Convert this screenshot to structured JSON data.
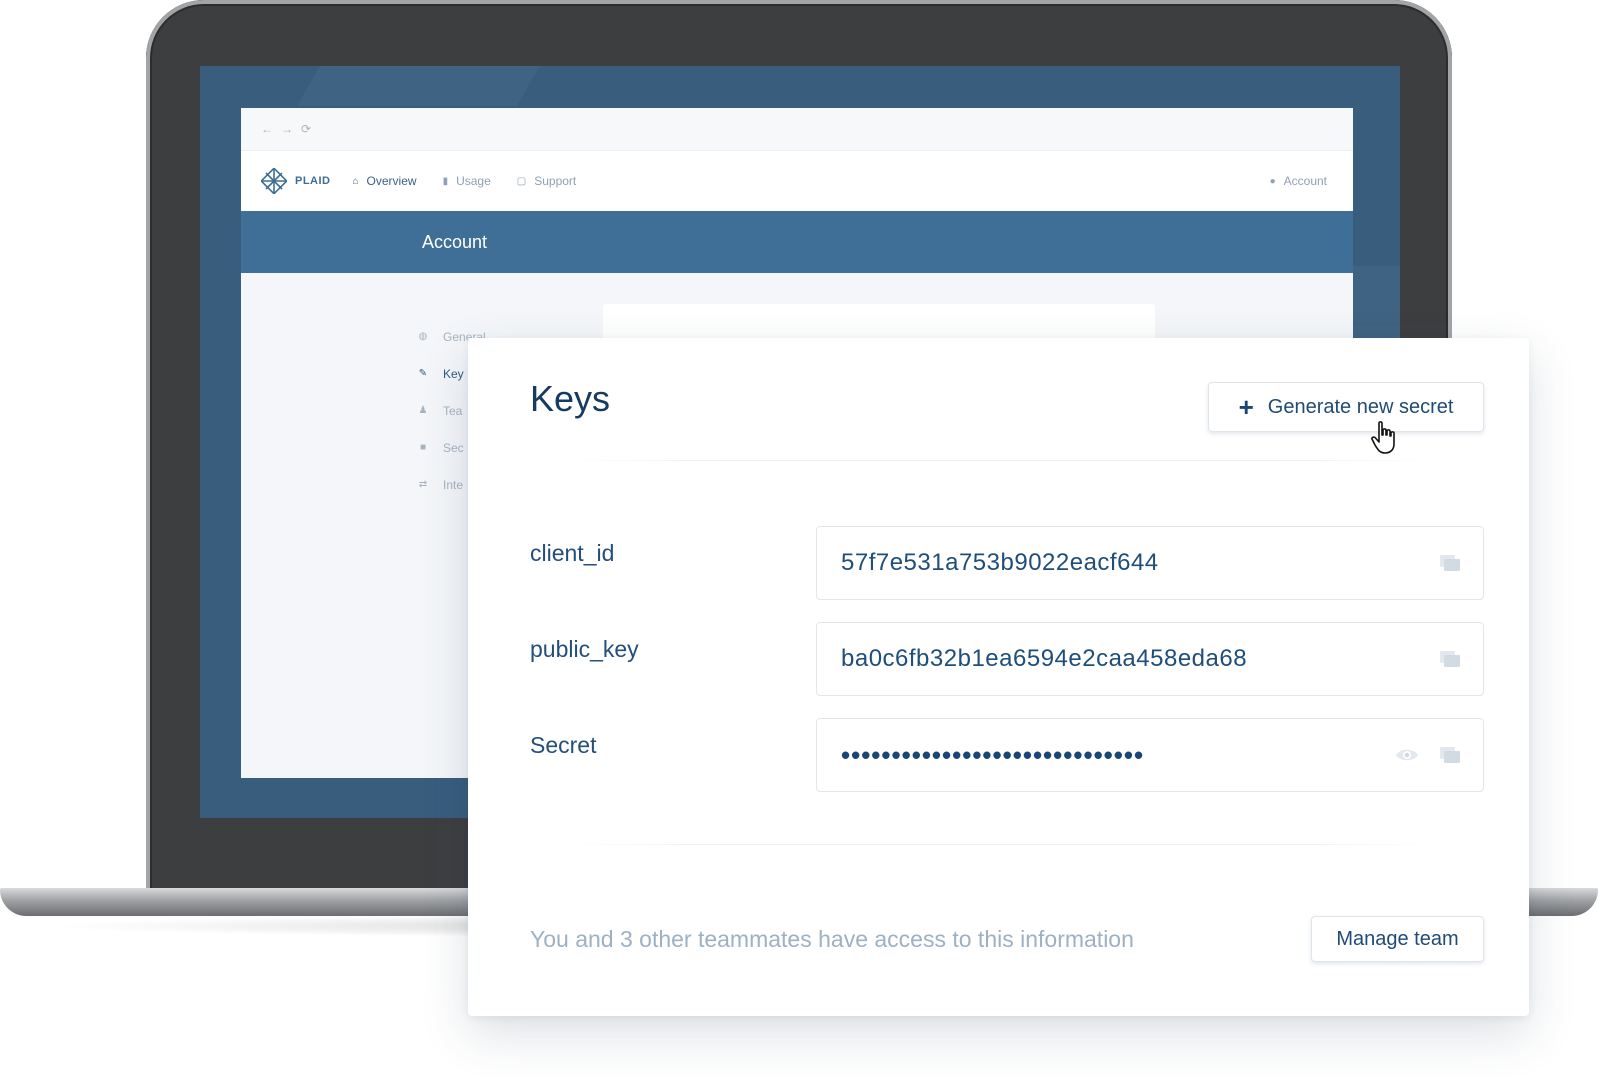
{
  "browser": {
    "nav_back_icon": "arrow-left-icon",
    "nav_forward_icon": "arrow-right-icon",
    "reload_icon": "reload-icon"
  },
  "app_nav": {
    "brand": "PLAID",
    "items": [
      {
        "label": "Overview",
        "icon": "home-icon",
        "active": true
      },
      {
        "label": "Usage",
        "icon": "bar-chart-icon",
        "active": false
      },
      {
        "label": "Support",
        "icon": "chat-icon",
        "active": false
      }
    ],
    "account_label": "Account"
  },
  "banner": {
    "title": "Account"
  },
  "sidebar": {
    "items": [
      {
        "label": "General",
        "icon": "globe-icon"
      },
      {
        "label": "Key",
        "icon": "key-icon"
      },
      {
        "label": "Tea",
        "icon": "team-icon"
      },
      {
        "label": "Sec",
        "icon": "lock-icon"
      },
      {
        "label": "Inte",
        "icon": "transfer-icon"
      }
    ]
  },
  "keys": {
    "title": "Keys",
    "generate_button": "Generate new secret",
    "fields": [
      {
        "label": "client_id",
        "value": "57f7e531a753b9022eacf644"
      },
      {
        "label": "public_key",
        "value": "ba0c6fb32b1ea6594e2caa458eda68"
      },
      {
        "label": "Secret",
        "value": "••••••••••••••••••••••••••••••"
      }
    ],
    "footer_text": "You and 3 other teammates have access to this information",
    "manage_button": "Manage team"
  },
  "colors": {
    "brand_blue": "#3f6e96",
    "text_primary": "#1f4b74",
    "text_muted": "#9db1c4"
  }
}
